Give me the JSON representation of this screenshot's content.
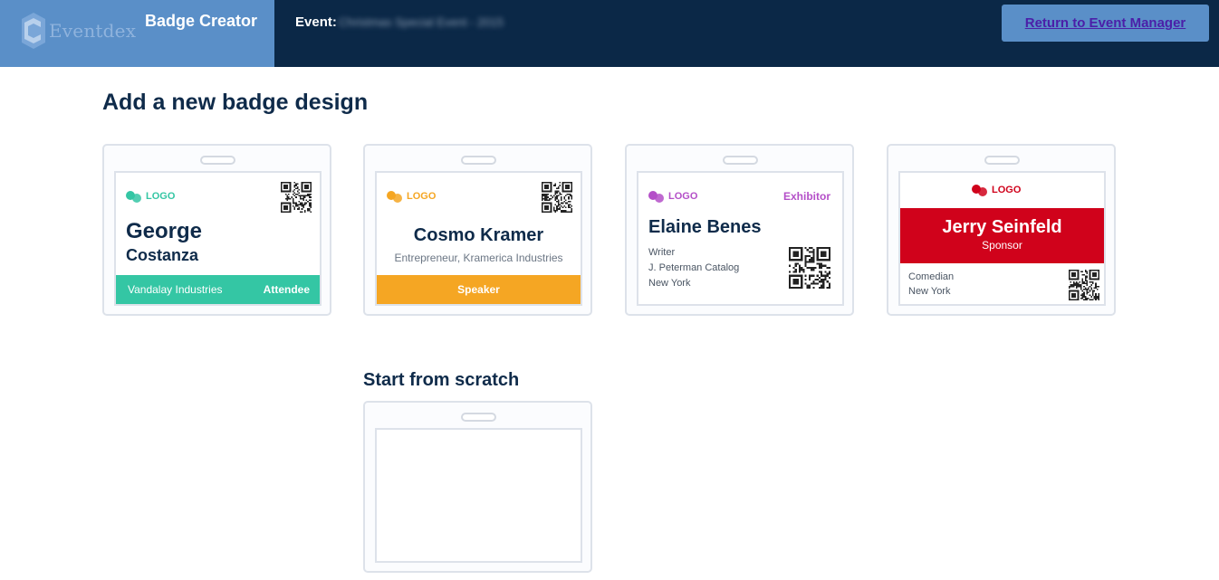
{
  "header": {
    "logo_text": "Eventdex",
    "app_title": "Badge Creator",
    "event_label": "Event:",
    "event_name": "Christmas Special Event - 2015",
    "return_button": "Return to Event Manager",
    "colors": {
      "bar": "#0b2847",
      "brand_block": "#5a8fc8",
      "button": "#5a8fc8"
    }
  },
  "main": {
    "heading": "Add a new badge design",
    "scratch_heading": "Start from scratch"
  },
  "templates": [
    {
      "logo": "LOGO",
      "first_name": "George",
      "last_name": "Costanza",
      "organization": "Vandalay Industries",
      "role": "Attendee",
      "accent": "#34c6a4",
      "icon": "qr-code-icon"
    },
    {
      "logo": "LOGO",
      "name": "Cosmo Kramer",
      "subtitle": "Entrepreneur, Kramerica Industries",
      "role": "Speaker",
      "accent": "#f5a623",
      "icon": "qr-code-icon"
    },
    {
      "logo": "LOGO",
      "name": "Elaine Benes",
      "role": "Exhibitor",
      "lines": [
        "Writer",
        "J. Peterman Catalog",
        "New York"
      ],
      "accent": "#b44fc8",
      "icon": "qr-code-icon"
    },
    {
      "logo": "LOGO",
      "name": "Jerry Seinfeld",
      "role": "Sponsor",
      "lines": [
        "Comedian",
        "New York"
      ],
      "accent": "#d0021b",
      "icon": "qr-code-icon"
    }
  ]
}
